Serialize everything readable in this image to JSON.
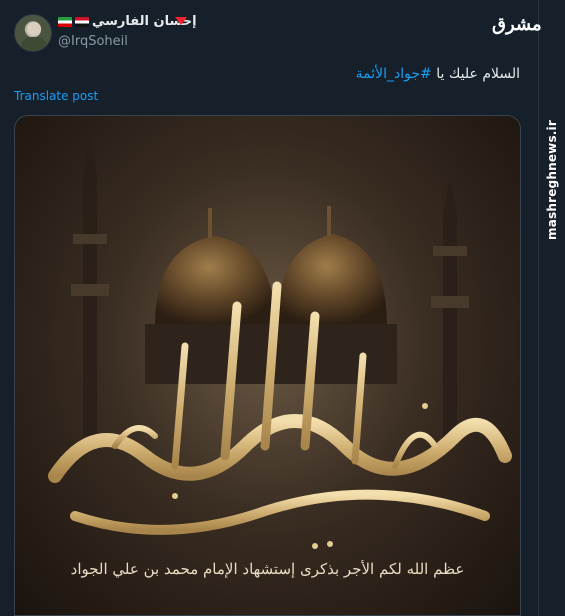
{
  "post": {
    "display_name": "إحسان الفارسي",
    "handle": "@IrqSoheil",
    "text_prefix": "السلام عليك يا ",
    "hashtag": "#جواد_الأئمة",
    "translate_label": "Translate post"
  },
  "media": {
    "calligraphy": "محمد بن علي الجواد",
    "calligraphy_small": "عليه السلام",
    "caption": "عظم الله لكم الأجر بذكرى إستشهاد الإمام محمد بن علي الجواد"
  },
  "watermark": {
    "logo": "مشرق",
    "url": "mashreghnews.ir"
  },
  "colors": {
    "background": "#15202b",
    "link": "#1d9bf0",
    "text": "#e7e9ea",
    "muted": "#8b98a5"
  }
}
